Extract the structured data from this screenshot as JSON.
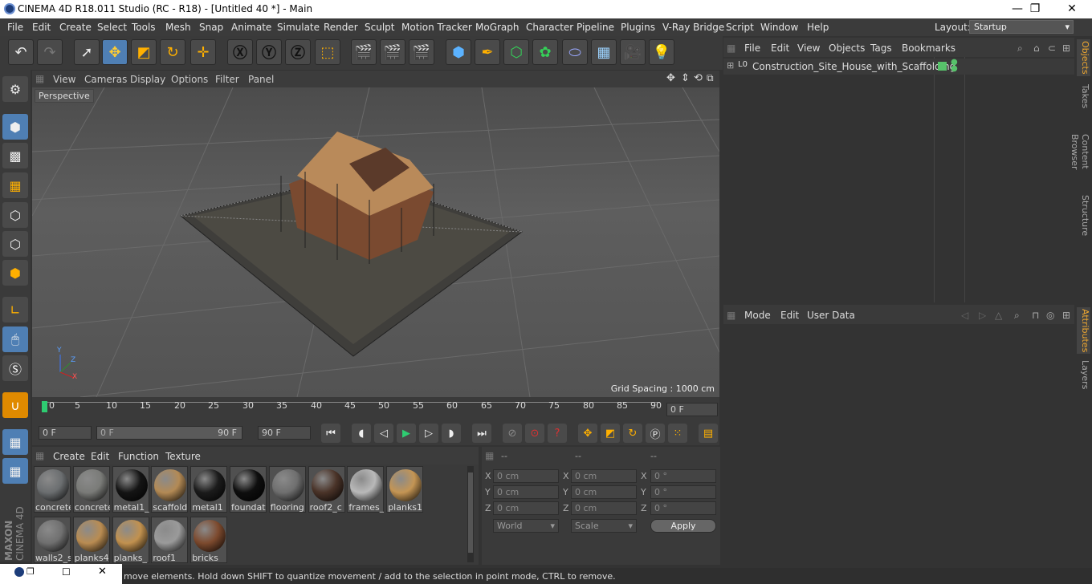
{
  "window": {
    "title": "CINEMA 4D R18.011 Studio (RC - R18) - [Untitled 40 *] - Main",
    "min": "—",
    "max": "❐",
    "close": "✕"
  },
  "menubar": {
    "items": [
      "File",
      "Edit",
      "Create",
      "Select",
      "Tools",
      "Mesh",
      "Snap",
      "Animate",
      "Simulate",
      "Render",
      "Sculpt",
      "Motion Tracker",
      "MoGraph",
      "Character",
      "Pipeline",
      "Plugins",
      "V-Ray Bridge",
      "Script",
      "Window",
      "Help"
    ],
    "layout_label": "Layout:",
    "layout_value": "Startup"
  },
  "viewport": {
    "menu": [
      "View",
      "Cameras",
      "Display",
      "Options",
      "Filter",
      "Panel"
    ],
    "camera_label": "Perspective",
    "grid_spacing": "Grid Spacing : 1000 cm",
    "axis": {
      "x": "X",
      "y": "Y",
      "z": "Z"
    }
  },
  "timeline": {
    "ticks": [
      "0",
      "5",
      "10",
      "15",
      "20",
      "25",
      "30",
      "35",
      "40",
      "45",
      "50",
      "55",
      "60",
      "65",
      "70",
      "75",
      "80",
      "85",
      "90"
    ],
    "current_frame": "0 F"
  },
  "transport": {
    "start": "0 F",
    "range_start": "0 F",
    "range_end": "90 F",
    "end": "90 F"
  },
  "materials": {
    "menu": [
      "Create",
      "Edit",
      "Function",
      "Texture"
    ],
    "items": [
      {
        "name": "concrete",
        "color": "#6b6e70"
      },
      {
        "name": "concrete",
        "color": "#7a7b78"
      },
      {
        "name": "metal1_(",
        "color": "#141414"
      },
      {
        "name": "scaffold",
        "color": "#b38a55"
      },
      {
        "name": "metal1",
        "color": "#1b1b1b"
      },
      {
        "name": "foundat",
        "color": "#0e0e0e"
      },
      {
        "name": "flooring",
        "color": "#6f6f6f"
      },
      {
        "name": "roof2_c",
        "color": "#4a3328"
      },
      {
        "name": "frames_",
        "color": "#b9b9b9"
      },
      {
        "name": "planks1",
        "color": "#c49554"
      },
      {
        "name": "walls2_s",
        "color": "#707070"
      },
      {
        "name": "planks4",
        "color": "#b98c52"
      },
      {
        "name": "planks_",
        "color": "#c1914f"
      },
      {
        "name": "roof1",
        "color": "#9a9a9a"
      },
      {
        "name": "bricks",
        "color": "#7d4a2e"
      }
    ]
  },
  "coords": {
    "headers": [
      "--",
      "--",
      "--"
    ],
    "rows": [
      {
        "axis": "X",
        "pos": "0 cm",
        "size": "0 cm",
        "rot_axis": "X",
        "rot": "0 °"
      },
      {
        "axis": "Y",
        "pos": "0 cm",
        "size": "0 cm",
        "rot_axis": "Y",
        "rot": "0 °"
      },
      {
        "axis": "Z",
        "pos": "0 cm",
        "size": "0 cm",
        "rot_axis": "Z",
        "rot": "0 °"
      }
    ],
    "space": "World",
    "mode": "Scale",
    "apply": "Apply"
  },
  "objects": {
    "menu": [
      "File",
      "Edit",
      "View",
      "Objects",
      "Tags",
      "Bookmarks"
    ],
    "items": [
      {
        "name": "Construction_Site_House_with_Scaffolding",
        "layer": "L0"
      }
    ]
  },
  "attributes": {
    "menu": [
      "Mode",
      "Edit",
      "User Data"
    ]
  },
  "sidetabs": [
    "Objects",
    "Takes",
    "Content Browser",
    "Structure",
    "Attributes",
    "Layers"
  ],
  "status": {
    "text": "move elements. Hold down SHIFT to quantize movement / add to the selection in point mode, CTRL to remove."
  },
  "brand": {
    "maxon": "MAXON",
    "product": "CINEMA 4D"
  },
  "accent": "#4f7fb4"
}
